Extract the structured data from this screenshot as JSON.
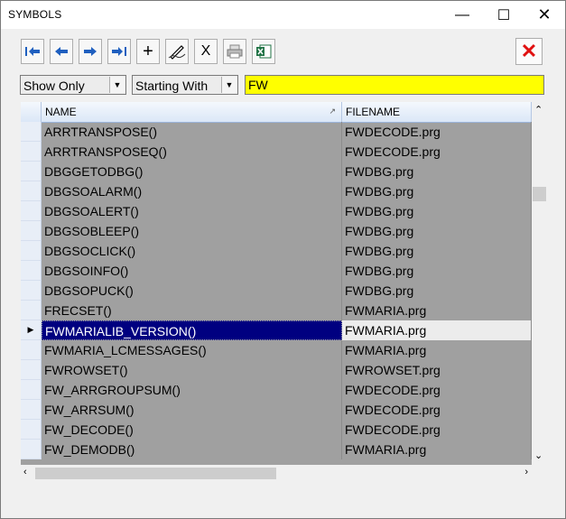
{
  "window": {
    "title": "SYMBOLS"
  },
  "titlebar": {
    "minimize": "—",
    "maximize": "☐",
    "close": "✕"
  },
  "toolbar": {
    "first_icon": "first-record-icon",
    "prev_icon": "previous-record-icon",
    "next_icon": "next-record-icon",
    "last_icon": "last-record-icon",
    "add_label": "+",
    "edit_icon": "edit-pen-icon",
    "delete_label": "X",
    "print_icon": "printer-icon",
    "excel_icon": "excel-export-icon",
    "close_label": "✕",
    "accent": "#1f5fbf",
    "close_color": "#e01010"
  },
  "filter": {
    "mode_value": "Show Only",
    "match_value": "Starting With",
    "search_value": "FW",
    "search_bg": "#ffff00"
  },
  "grid": {
    "columns": [
      {
        "label": "NAME",
        "sorted": "↗"
      },
      {
        "label": "FILENAME"
      }
    ],
    "selected_marker": "▶",
    "rows": [
      {
        "name": "ARRTRANSPOSE()",
        "file": "FWDECODE.prg"
      },
      {
        "name": "ARRTRANSPOSEQ()",
        "file": "FWDECODE.prg"
      },
      {
        "name": "DBGGETODBG()",
        "file": "FWDBG.prg"
      },
      {
        "name": "DBGSOALARM()",
        "file": "FWDBG.prg"
      },
      {
        "name": "DBGSOALERT()",
        "file": "FWDBG.prg"
      },
      {
        "name": "DBGSOBLEEP()",
        "file": "FWDBG.prg"
      },
      {
        "name": "DBGSOCLICK()",
        "file": "FWDBG.prg"
      },
      {
        "name": "DBGSOINFO()",
        "file": "FWDBG.prg"
      },
      {
        "name": "DBGSOPUCK()",
        "file": "FWDBG.prg"
      },
      {
        "name": "FRECSET()",
        "file": "FWMARIA.prg"
      },
      {
        "name": "FWMARIALIB_VERSION()",
        "file": "FWMARIA.prg",
        "selected": true
      },
      {
        "name": "FWMARIA_LCMESSAGES()",
        "file": "FWMARIA.prg"
      },
      {
        "name": "FWROWSET()",
        "file": "FWROWSET.prg"
      },
      {
        "name": "FW_ARRGROUPSUM()",
        "file": "FWDECODE.prg"
      },
      {
        "name": "FW_ARRSUM()",
        "file": "FWDECODE.prg"
      },
      {
        "name": "FW_DECODE()",
        "file": "FWDECODE.prg"
      },
      {
        "name": "FW_DEMODB()",
        "file": "FWMARIA.prg"
      }
    ]
  },
  "scrollbars": {
    "up": "⌃",
    "down": "⌄",
    "left": "‹",
    "right": "›"
  }
}
